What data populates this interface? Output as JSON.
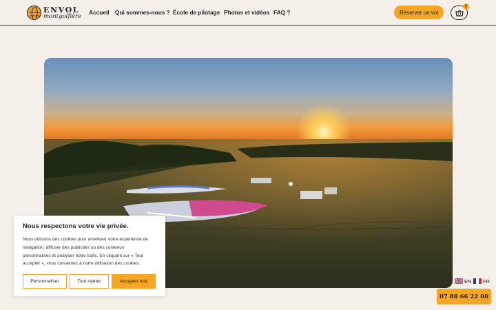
{
  "logo": {
    "line1": "ENVOL",
    "line2": "montgolfière"
  },
  "nav": {
    "items": [
      {
        "label": "Accueil"
      },
      {
        "label": "Qui sommes-nous ?"
      },
      {
        "label": "École de pilotage"
      },
      {
        "label": "Photos et vidéos"
      },
      {
        "label": "FAQ ?"
      }
    ]
  },
  "header": {
    "book_label": "Réserver un vol",
    "cart_count": "0"
  },
  "cookie": {
    "title": "Nous respectons votre vie privée.",
    "lines": [
      "Nous utilisons des cookies pour améliorer votre expérience de",
      "navigation, diffuser des publicités ou des contenus",
      "personnalisés et analyser notre trafic. En cliquant sur « Tout",
      "accepter », vous consentez à notre utilisation des cookies."
    ],
    "customize_label": "Personnaliser",
    "reject_label": "Tout rejeter",
    "accept_label": "Accepter tout"
  },
  "language": {
    "en": "EN",
    "fr": "FR"
  },
  "phone": "07 88 66 22 00",
  "colors": {
    "accent": "#f5a623",
    "background": "#f5efe9",
    "text": "#1e1e1e"
  },
  "icons": {
    "cart": "basket-icon",
    "logo": "balloon-logo-icon"
  }
}
